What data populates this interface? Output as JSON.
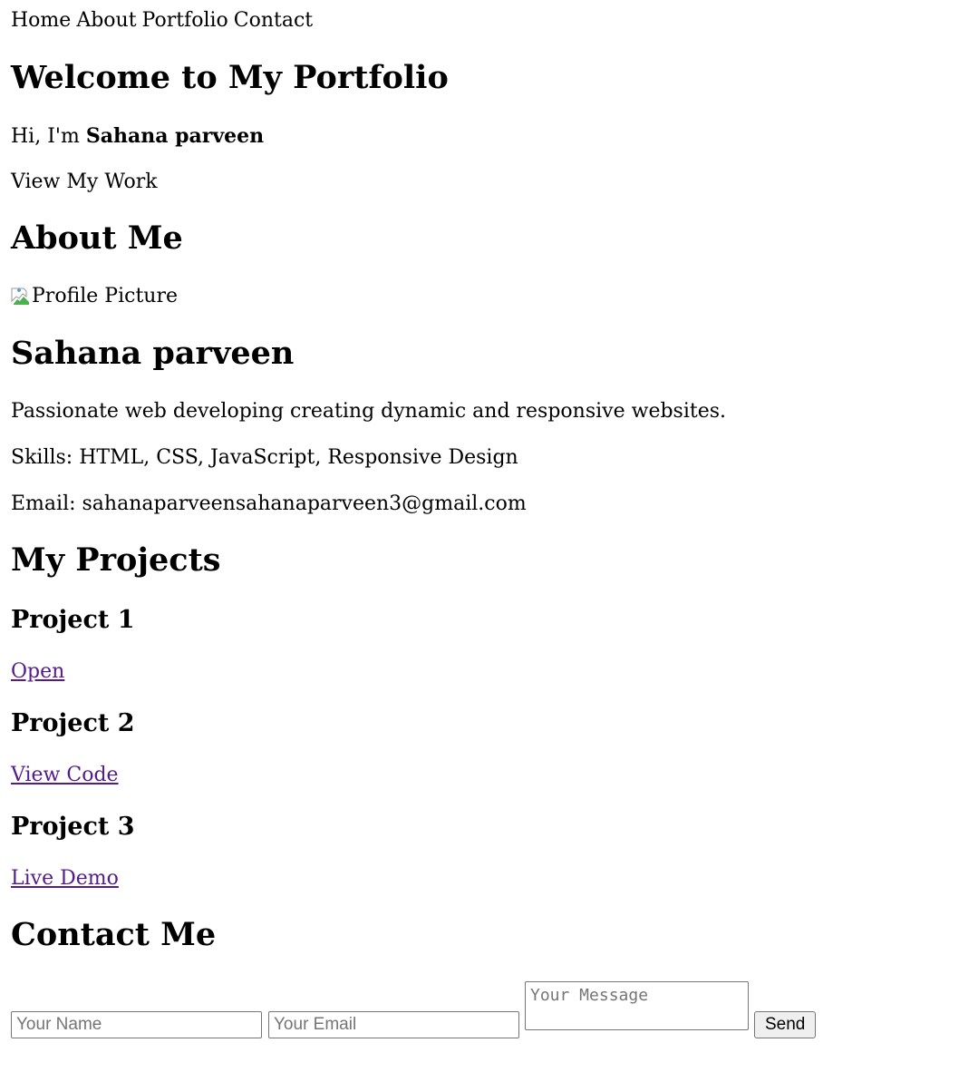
{
  "nav": {
    "items": [
      "Home",
      "About",
      "Portfolio",
      "Contact"
    ]
  },
  "hero": {
    "title": "Welcome to My Portfolio",
    "greeting_prefix": "Hi, I'm ",
    "name": "Sahana parveen",
    "cta": "View My Work"
  },
  "about": {
    "title": "About Me",
    "image_alt": "Profile Picture",
    "name": "Sahana parveen",
    "bio": "Passionate web developing creating dynamic and responsive websites.",
    "skills": "Skills: HTML, CSS, JavaScript, Responsive Design",
    "email": "Email: sahanaparveensahanaparveen3@gmail.com"
  },
  "projects": {
    "title": "My Projects",
    "items": [
      {
        "title": "Project 1",
        "link": "Open"
      },
      {
        "title": "Project 2",
        "link": "View Code"
      },
      {
        "title": "Project 3",
        "link": "Live Demo"
      }
    ]
  },
  "contact": {
    "title": "Contact Me",
    "name_placeholder": "Your Name",
    "email_placeholder": "Your Email",
    "message_placeholder": "Your Message",
    "send_label": "Send"
  },
  "colors": {
    "link_visited": "#551a8b",
    "text": "#000000",
    "placeholder": "#757575",
    "button_bg": "#efefef"
  }
}
